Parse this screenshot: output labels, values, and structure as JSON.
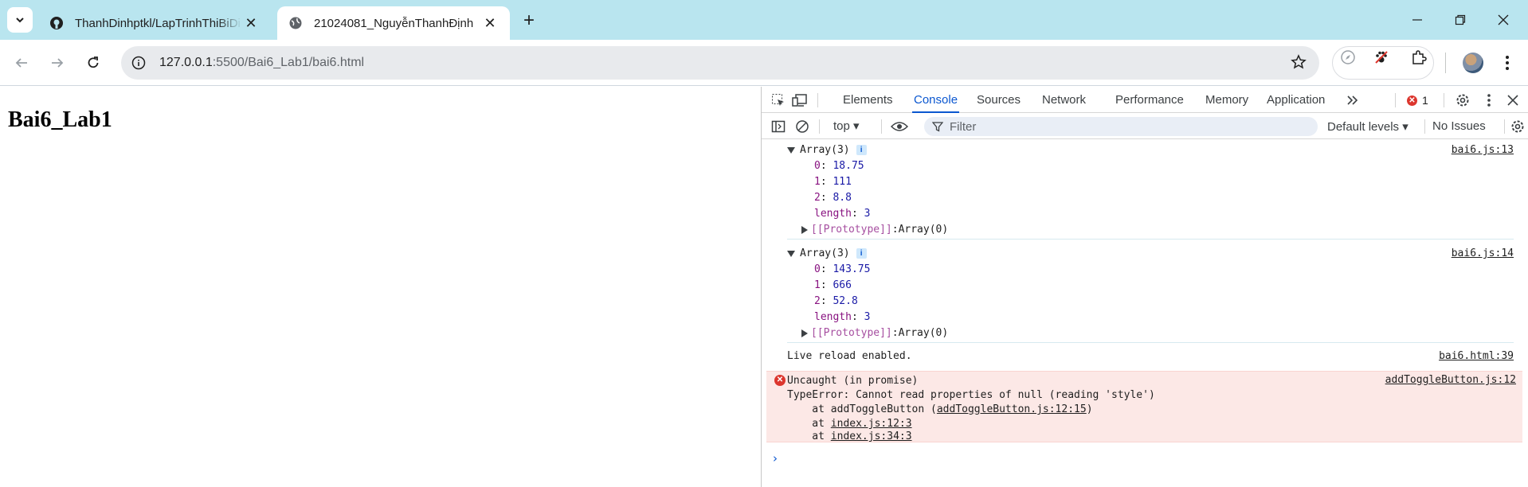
{
  "tabs": [
    {
      "title": "ThanhDinhptkl/LapTrinhThiBiDi",
      "favicon": "github-icon"
    },
    {
      "title": "21024081_NguyễnThanhĐịnh",
      "favicon": "globe-icon"
    }
  ],
  "address": {
    "host": "127.0.0.1",
    "path": ":5500/Bai6_Lab1/bai6.html"
  },
  "page": {
    "heading": "Bai6_Lab1"
  },
  "devtools": {
    "tabs": [
      "Elements",
      "Console",
      "Sources",
      "Network",
      "Performance",
      "Memory",
      "Application"
    ],
    "active_tab": "Console",
    "error_count": "1",
    "context": "top",
    "filter_placeholder": "Filter",
    "levels": "Default levels",
    "issues": "No Issues",
    "messages": [
      {
        "header": "Array(3)",
        "source": "bai6.js:13",
        "props": [
          {
            "key": "0",
            "value": "18.75"
          },
          {
            "key": "1",
            "value": "111"
          },
          {
            "key": "2",
            "value": "8.8"
          },
          {
            "key": "length",
            "value": "3"
          }
        ],
        "proto_key": "[[Prototype]]",
        "proto_value": "Array(0)"
      },
      {
        "header": "Array(3)",
        "source": "bai6.js:14",
        "props": [
          {
            "key": "0",
            "value": "143.75"
          },
          {
            "key": "1",
            "value": "666"
          },
          {
            "key": "2",
            "value": "52.8"
          },
          {
            "key": "length",
            "value": "3"
          }
        ],
        "proto_key": "[[Prototype]]",
        "proto_value": "Array(0)"
      }
    ],
    "log": {
      "text": "Live reload enabled.",
      "source": "bai6.html:39"
    },
    "error": {
      "title": "Uncaught (in promise)",
      "message": "TypeError: Cannot read properties of null (reading 'style')",
      "source": "addToggleButton.js:12",
      "stack": [
        {
          "prefix": "    at addToggleButton (",
          "link": "addToggleButton.js:12:15",
          "suffix": ")"
        },
        {
          "prefix": "    at ",
          "link": "index.js:12:3",
          "suffix": ""
        },
        {
          "prefix": "    at ",
          "link": "index.js:34:3",
          "suffix": ""
        }
      ]
    },
    "prompt": "›"
  }
}
